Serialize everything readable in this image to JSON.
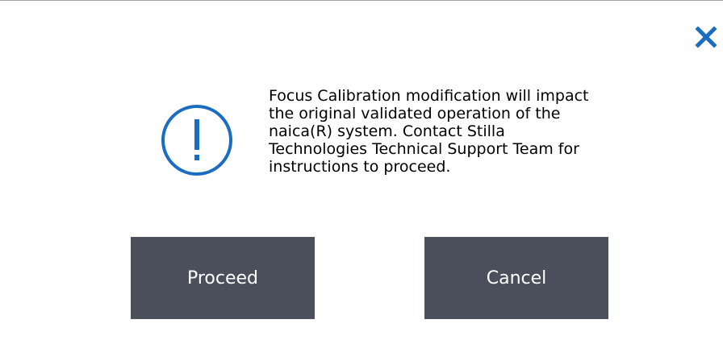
{
  "dialog": {
    "message": "Focus Calibration modification will impact\nthe original validated operation of the\nnaica(R) system. Contact Stilla\nTechnologies Technical Support Team for\ninstructions to proceed.",
    "icon": "exclamation-circle-icon",
    "close_icon": "close-icon",
    "proceed_label": "Proceed",
    "cancel_label": "Cancel"
  },
  "colors": {
    "accent": "#1b6dc1",
    "button_bg": "#4a4f5b",
    "button_text": "#ffffff",
    "text": "#000000"
  }
}
